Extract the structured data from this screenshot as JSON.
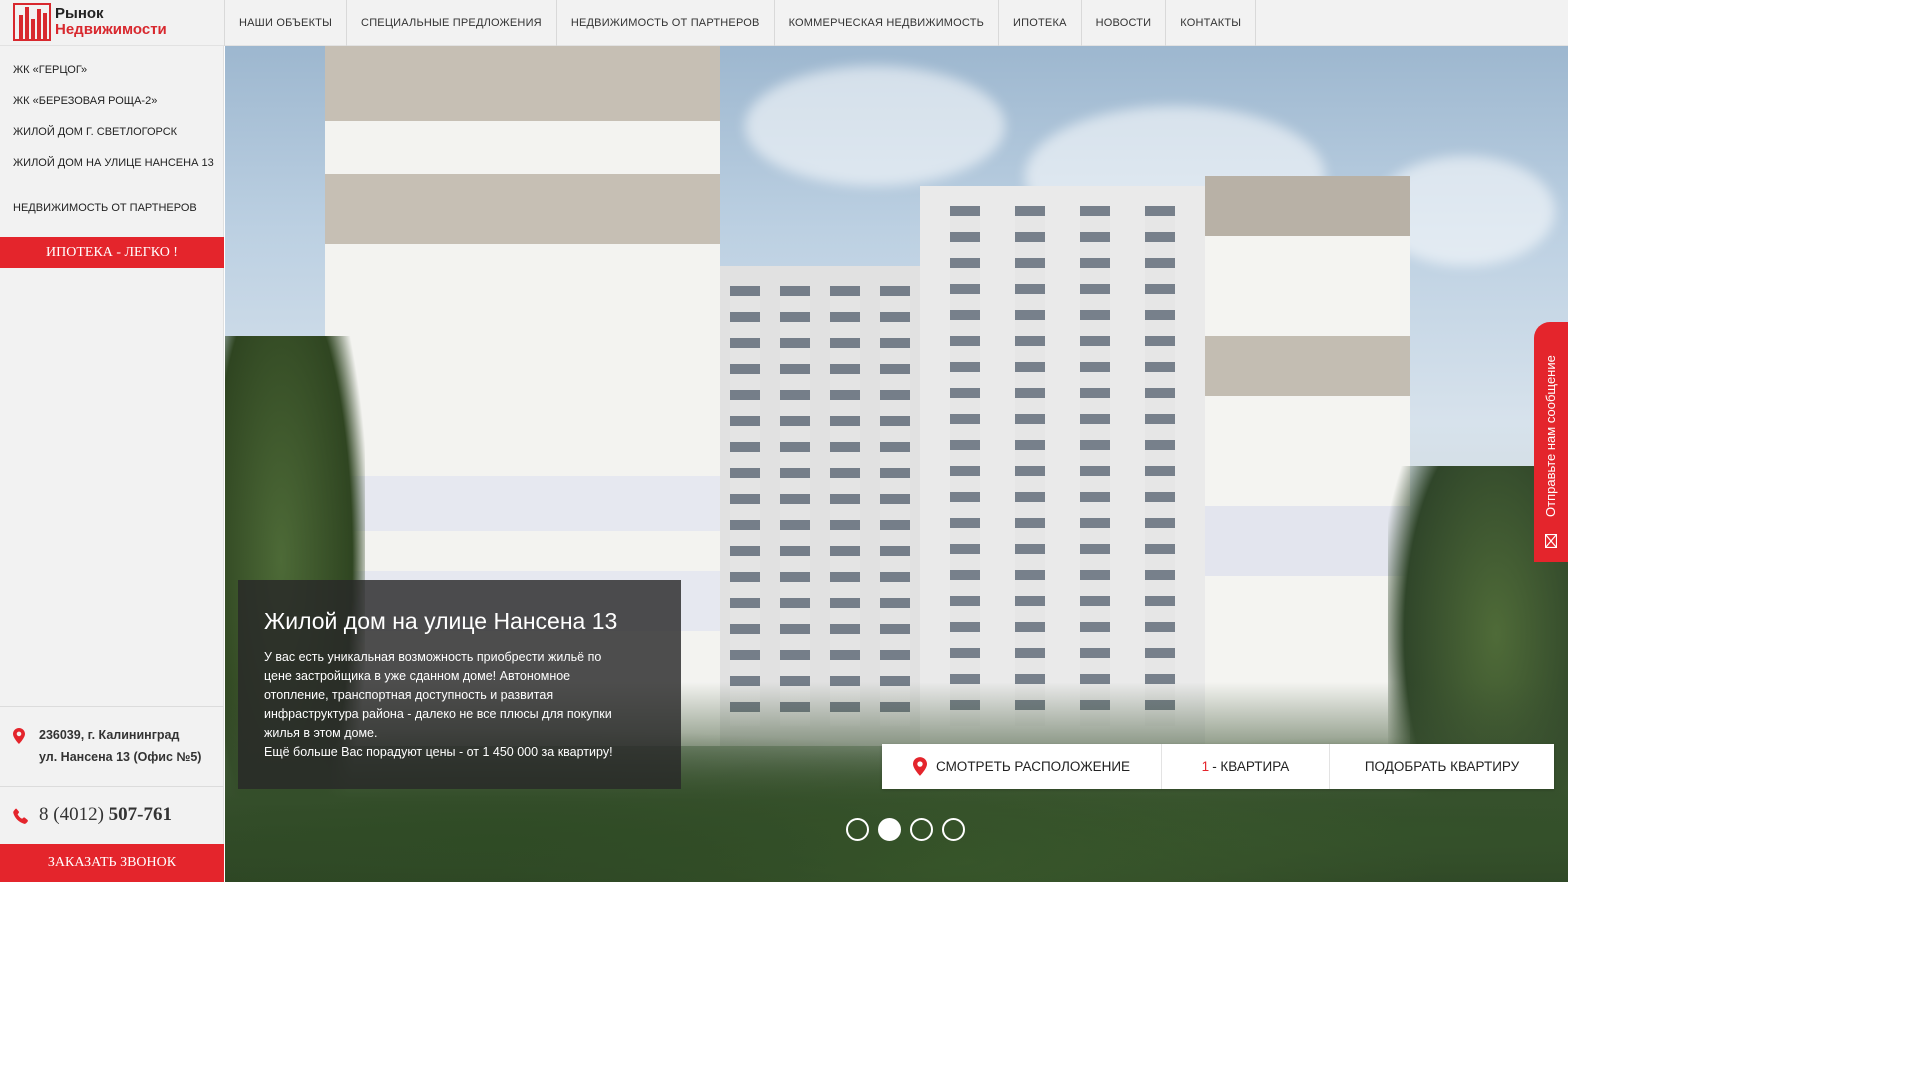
{
  "logo": {
    "line1": "Рынок",
    "line2": "Недвижимости"
  },
  "nav": {
    "items": [
      "НАШИ ОБЪЕКТЫ",
      "СПЕЦИАЛЬНЫЕ ПРЕДЛОЖЕНИЯ",
      "НЕДВИЖИМОСТЬ ОТ ПАРТНЕРОВ",
      "КОММЕРЧЕСКАЯ НЕДВИЖИМОСТЬ",
      "ИПОТЕКА",
      "НОВОСТИ",
      "КОНТАКТЫ"
    ]
  },
  "sidebar": {
    "links": [
      "ЖК «ГЕРЦОГ»",
      "ЖК «БЕРЕЗОВАЯ РОЩА-2»",
      "ЖИЛОЙ ДОМ Г. СВЕТЛОГОРСК",
      "ЖИЛОЙ ДОМ НА УЛИЦЕ НАНСЕНА 13"
    ],
    "partners_link": "НЕДВИЖИМОСТЬ ОТ ПАРТНЕРОВ",
    "mortgage_button": "ИПОТЕКА - ЛЕГКО !",
    "address_line1": "236039, г. Калининград",
    "address_line2": "ул. Нансена 13 (Офис №5)",
    "phone_prefix": "8 (4012) ",
    "phone_number": "507-761",
    "call_button": "ЗАКАЗАТЬ ЗВОНОК"
  },
  "hero": {
    "title": "Жилой дом на улице Нансена 13",
    "text_lines": [
      "У вас есть уникальная возможность приобрести жильё по",
      "цене застройщика в уже сданном доме! Автономное",
      "отопление, транспортная доступность и развитая",
      "инфраструктура района - далеко не все плюсы для покупки",
      "жилья в этом доме.",
      "Ещё больше Вас порадуют цены - от 1 450 000 за квартиру!"
    ],
    "actions": {
      "location": "СМОТРЕТЬ РАСПОЛОЖЕНИЕ",
      "count_number": "1",
      "count_label": " - КВАРТИРА",
      "pick": "ПОДОБРАТЬ КВАРТИРУ"
    },
    "slides_total": 4,
    "active_slide": 2
  },
  "feedback_tab": "Отправьте нам сообщение",
  "colors": {
    "accent": "#e4252c",
    "sidebar_bg": "#f2f2f2"
  },
  "icons": [
    "map-pin-icon",
    "phone-icon",
    "mail-icon"
  ]
}
